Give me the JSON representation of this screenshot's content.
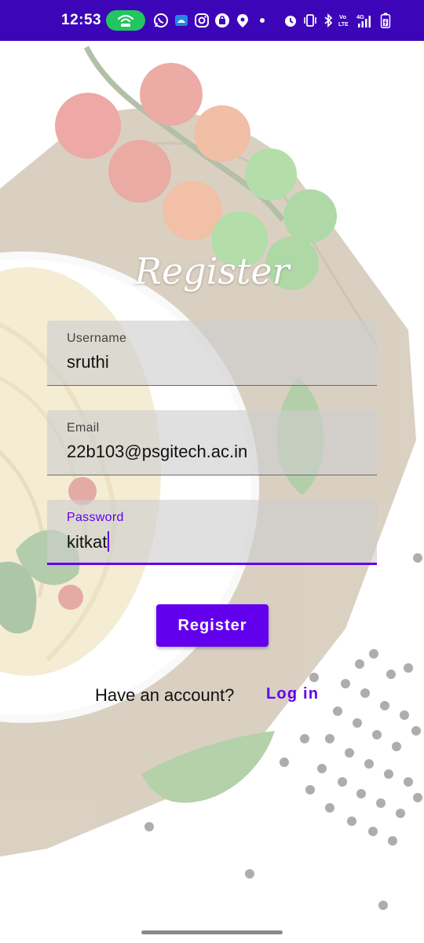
{
  "status_bar": {
    "time": "12:53",
    "icons": [
      "hotspot-icon",
      "whatsapp-icon",
      "android-icon",
      "instagram-icon",
      "shopping-bag-icon",
      "location-icon",
      "alarm-icon",
      "vibrate-icon",
      "bluetooth-icon",
      "volte-icon",
      "signal-4g-icon",
      "battery-icon"
    ],
    "background_color": "#3d05b8",
    "volte_text": "Vo LTE",
    "network_text": "4G"
  },
  "form": {
    "title": "Register",
    "username": {
      "label": "Username",
      "value": "sruthi"
    },
    "email": {
      "label": "Email",
      "value": "22b103@psgitech.ac.in"
    },
    "password": {
      "label": "Password",
      "value": "kitkat"
    },
    "register_button": "Register",
    "have_account_text": "Have an account?",
    "login_link": "Log in"
  },
  "colors": {
    "accent": "#6200ee",
    "status_bar": "#3d05b8",
    "hotspot_pill": "#22c55e"
  }
}
